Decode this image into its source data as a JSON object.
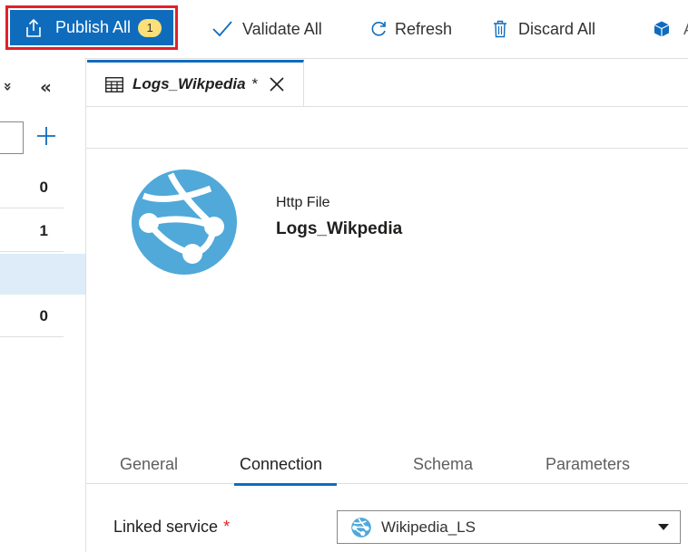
{
  "toolbar": {
    "publish_label": "Publish All",
    "publish_badge": "1",
    "validate_label": "Validate All",
    "refresh_label": "Refresh",
    "discard_label": "Discard All",
    "more_label": "A"
  },
  "left_pane": {
    "collapse_all_icon": "»",
    "collapse_pane_icon": "«",
    "rows": [
      {
        "count": "0"
      },
      {
        "count": "1"
      },
      {
        "count": ""
      },
      {
        "count": "0"
      }
    ]
  },
  "editor": {
    "tab_title": "Logs_Wikpedia",
    "tab_dirty": "*",
    "dataset_type": "Http File",
    "dataset_name": "Logs_Wikpedia"
  },
  "properties": {
    "tabs": [
      "General",
      "Connection",
      "Schema",
      "Parameters"
    ],
    "active_tab": "Connection",
    "linked_service_label": "Linked service",
    "required_marker": "*",
    "linked_service_value": "Wikipedia_LS"
  },
  "colors": {
    "accent": "#0f6cbd",
    "highlight_border": "#e3202a",
    "badge": "#fbe07a",
    "selected_row": "#deecf9",
    "globe": "#50a9d9"
  },
  "icons": {
    "publish": "upload-icon",
    "validate": "checkmark-icon",
    "refresh": "refresh-icon",
    "discard": "trash-icon",
    "more": "package-icon",
    "tab": "table-icon",
    "close": "close-icon",
    "dataset": "globe-network-icon",
    "add": "plus-icon"
  }
}
